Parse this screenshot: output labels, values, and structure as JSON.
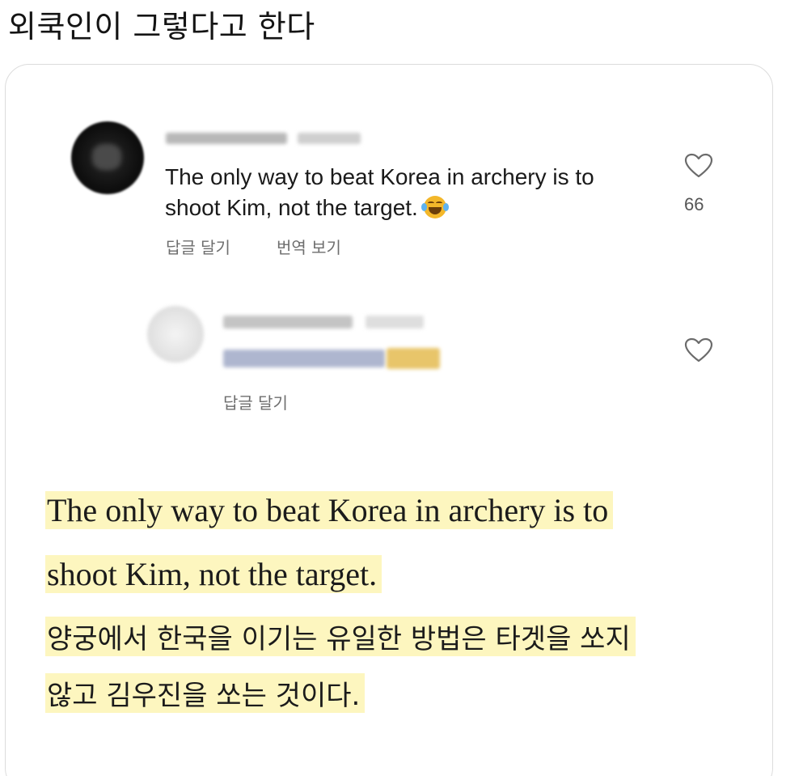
{
  "post": {
    "title": "외쿡인이 그렇다고 한다"
  },
  "comment": {
    "text": "The only way to beat Korea in archery is to shoot Kim, not the target.",
    "emoji": "face-with-tears-of-joy",
    "like_count": "66",
    "reply_action": "답글 달기",
    "translate_action": "번역 보기"
  },
  "reply": {
    "reply_action": "답글 달기"
  },
  "caption": {
    "english_lines": [
      "The only way to beat Korea in archery is to",
      "shoot Kim, not the target."
    ],
    "korean_lines": [
      "양궁에서 한국을 이기는 유일한 방법은 타겟을 쏘지",
      "않고 김우진을 쏘는 것이다."
    ],
    "highlight_color": "#fdf6bf"
  }
}
